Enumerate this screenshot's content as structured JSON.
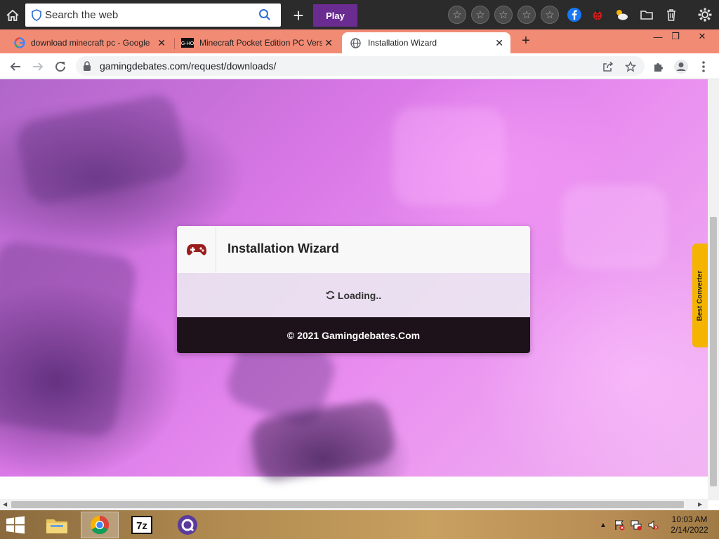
{
  "toolbar": {
    "search_placeholder": "Search the web",
    "play_label": "Play"
  },
  "tabs": [
    {
      "title": "download minecraft pc - Google",
      "icon": "google-icon"
    },
    {
      "title": "Minecraft Pocket Edition PC Vers",
      "icon": "site-icon"
    },
    {
      "title": "Installation Wizard",
      "icon": "globe-icon",
      "active": true
    }
  ],
  "address": {
    "url": "gamingdebates.com/request/downloads/"
  },
  "wizard": {
    "title": "Installation Wizard",
    "loading": "Loading..",
    "footer": "© 2021 Gamingdebates.Com",
    "icon": "gamepad-icon"
  },
  "side_tab": {
    "label": "Best Converter"
  },
  "taskbar": {
    "time": "10:03 AM",
    "date": "2/14/2022"
  },
  "colors": {
    "accent_play": "#6a2c91",
    "tabstrip": "#f28b74",
    "wizard_footer": "#1d1219",
    "gamepad": "#9b1c1c",
    "side_tab": "#f5b400"
  }
}
